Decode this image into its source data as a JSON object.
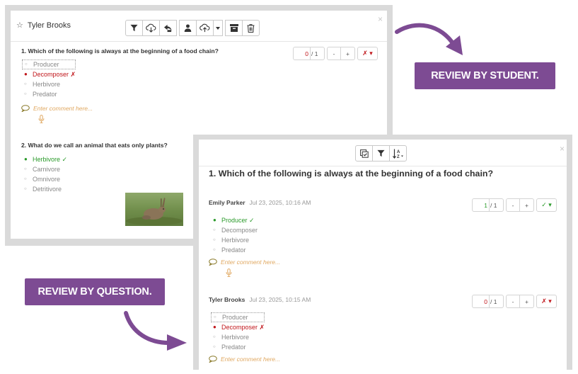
{
  "student_panel": {
    "student_name": "Tyler Brooks",
    "close_label": "×",
    "toolbar_icons": [
      "filter-icon",
      "cloud-download-icon",
      "reply-icon",
      "person-icon",
      "cloud-upload-icon",
      "caret-down-icon",
      "archive-icon",
      "trash-icon"
    ],
    "questions": [
      {
        "title": "1. Which of the following is always at the beginning of a food chain?",
        "options": [
          "Producer",
          "Decomposer ✗",
          "Herbivore",
          "Predator"
        ],
        "selected_index": 1,
        "score": "0",
        "out_of": "/ 1",
        "minus": "-",
        "plus": "+",
        "mark": "✗ ▾",
        "comment_placeholder": "Enter comment here..."
      },
      {
        "title": "2. What do we call an animal that eats only plants?",
        "options": [
          "Herbivore ✓",
          "Carnivore",
          "Omnivore",
          "Detritivore"
        ],
        "selected_index": 0
      }
    ]
  },
  "question_panel": {
    "close_label": "×",
    "toolbar_icons": [
      "checklist-icon",
      "filter-icon",
      "sort-az-icon"
    ],
    "question_title": "1. Which of the following is always at the beginning of a food chain?",
    "responses": [
      {
        "student_name": "Emily Parker",
        "date": "Jul 23, 2025, 10:16 AM",
        "score": "1",
        "out_of": "/ 1",
        "minus": "-",
        "plus": "+",
        "mark": "✓ ▾",
        "options": [
          "Producer ✓",
          "Decomposer",
          "Herbivore",
          "Predator"
        ],
        "selected_index": 0,
        "comment_placeholder": "Enter comment here..."
      },
      {
        "student_name": "Tyler Brooks",
        "date": "Jul 23, 2025, 10:15 AM",
        "score": "0",
        "out_of": "/ 1",
        "minus": "-",
        "plus": "+",
        "mark": "✗ ▾",
        "options": [
          "Producer",
          "Decomposer ✗",
          "Herbivore",
          "Predator"
        ],
        "selected_index": 1,
        "comment_placeholder": "Enter comment here..."
      }
    ]
  },
  "callouts": {
    "review_by_student": "REVIEW BY STUDENT.",
    "review_by_question": "REVIEW BY QUESTION."
  },
  "colors": {
    "badge_purple": "#7d4b93",
    "incorrect_red": "#c0151a",
    "correct_green": "#2a9a2a",
    "comment_orange": "#e0a861",
    "frame_gray": "#dadada"
  }
}
